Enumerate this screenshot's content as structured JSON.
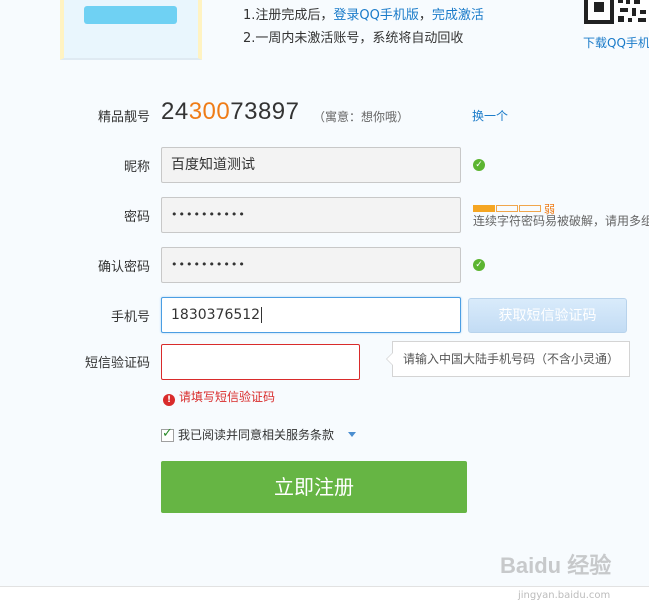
{
  "banner": {
    "tip_line1_prefix": "1.注册完成后，",
    "tip_line1_link1": "登录QQ手机版",
    "tip_line1_sep": "，",
    "tip_line1_link2": "完成激活",
    "tip_line2": "2.一周内未激活账号，系统将自动回收",
    "qr_caption": "下载QQ手机"
  },
  "account": {
    "label": "精品靓号",
    "number_prefix": "24",
    "number_highlight": "300",
    "number_suffix": "73897",
    "meaning": "（寓意：想你哦）",
    "change_link": "换一个"
  },
  "nickname": {
    "label": "昵称",
    "value": "百度知道测试"
  },
  "password": {
    "label": "密码",
    "value": "••••••••••",
    "strength_word": "弱",
    "hint": "连续字符密码易被破解，请用多组"
  },
  "confirm_password": {
    "label": "确认密码",
    "value": "••••••••••"
  },
  "phone": {
    "label": "手机号",
    "value": "1830376512",
    "sms_button": "获取短信验证码"
  },
  "sms_code": {
    "label": "短信验证码",
    "value": "",
    "tooltip": "请输入中国大陆手机号码（不含小灵通）",
    "error": "请填写短信验证码"
  },
  "agreement": {
    "text": "我已阅读并同意相关服务条款",
    "checked": true
  },
  "submit_label": "立即注册",
  "watermark": {
    "main": "Baidu 经验",
    "sub": "jingyan.baidu.com"
  }
}
